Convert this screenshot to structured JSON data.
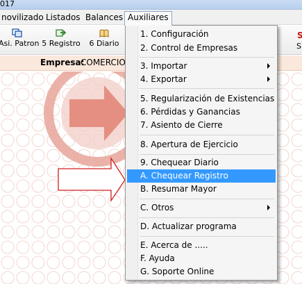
{
  "window": {
    "title_fragment": "017"
  },
  "menubar": {
    "items": [
      {
        "label": "novilizado"
      },
      {
        "label": "Listados"
      },
      {
        "label": "Balances"
      },
      {
        "label": "Auxiliares"
      }
    ]
  },
  "toolbar": {
    "buttons": [
      {
        "label": "Asi. Patron",
        "icon": "asiento-patron-icon"
      },
      {
        "label": "5 Registro",
        "icon": "registro-icon"
      },
      {
        "label": "6 Diario",
        "icon": "diario-book-icon"
      }
    ],
    "right_red": "S",
    "right_text": "S"
  },
  "empresa": {
    "label": "Empresa:",
    "value": "COMERCIO"
  },
  "dropdown": {
    "items": [
      {
        "label": "1. Configuración"
      },
      {
        "label": "2. Control de Empresas"
      },
      {
        "label": "3. Importar"
      },
      {
        "label": "4. Exportar"
      },
      {
        "label": "5. Regularización de Existencias"
      },
      {
        "label": "6. Pérdidas y Ganancias"
      },
      {
        "label": "7. Asiento de Cierre"
      },
      {
        "label": "8. Apertura de Ejercicio"
      },
      {
        "label": "9. Chequear Diario"
      },
      {
        "label": "A. Chequear Registro"
      },
      {
        "label": "B. Resumar Mayor"
      },
      {
        "label": "C. Otros"
      },
      {
        "label": "D. Actualizar programa"
      },
      {
        "label": "E. Acerca de ....."
      },
      {
        "label": "F. Ayuda"
      },
      {
        "label": "G. Soporte Online"
      }
    ]
  },
  "colors": {
    "highlight": "#3399ff",
    "accent_red": "#cc1111",
    "empresa_bg": "#fbe8dc"
  }
}
